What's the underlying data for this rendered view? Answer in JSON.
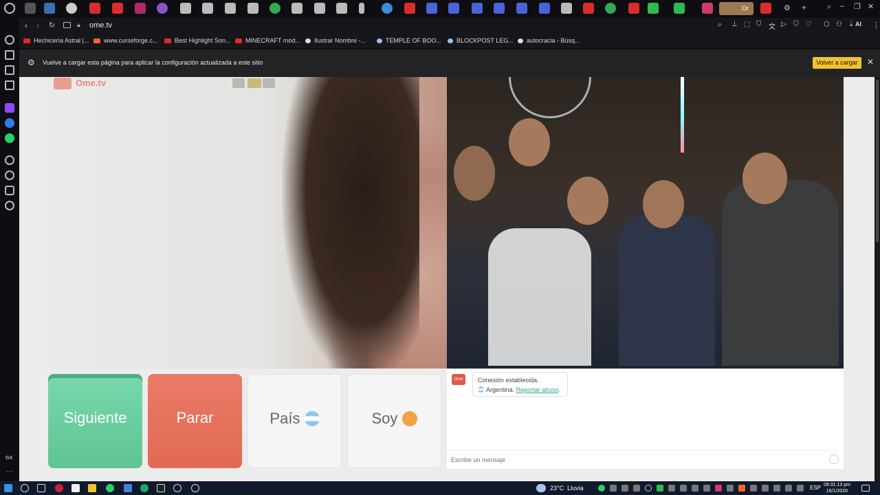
{
  "browser": {
    "url": "ome.tv",
    "bookmarks": [
      {
        "label": "Hechicería Astral |...",
        "color": "#e02b2b"
      },
      {
        "label": "www.curseforge.c...",
        "color": "#f0642e"
      },
      {
        "label": "Best Highlight Son...",
        "color": "#e02b2b"
      },
      {
        "label": "MINECRAFT mod...",
        "color": "#e02b2b"
      },
      {
        "label": "Ilustrar Nombre -...",
        "color": "#dddddd"
      },
      {
        "label": "TEMPLE OF BOO...",
        "color": "#9fc3e8"
      },
      {
        "label": "BLOCKPOST LEG...",
        "color": "#9fc3e8"
      },
      {
        "label": "autocracia - Búsq...",
        "color": "#dddddd"
      }
    ],
    "tab_badge_label": "Or",
    "ai_label": "AI",
    "gx_label": "GX"
  },
  "notification": {
    "text": "Vuelve a cargar esta página para aplicar la configuración actualizada a este sitio",
    "button_label": "Volver a cargar",
    "close_glyph": "✕"
  },
  "ometv": {
    "watermark": "Ome.tv",
    "buttons": {
      "next": "Siguiente",
      "stop": "Parar",
      "country": "País",
      "gender": "Soy"
    },
    "chat": {
      "logo_text": "Ome TV",
      "status": "Conexión establecida.",
      "country": "Argentina.",
      "report_link": "Reportar abuso",
      "input_placeholder": "Escribe un mensaje"
    },
    "accent_next": "#66c99a",
    "accent_stop": "#e4705b"
  },
  "taskbar": {
    "weather_temp": "23°C",
    "weather_desc": "Lluvia",
    "lang": "ESP",
    "time": "09:31:13 pm",
    "date": "16/1/2026"
  }
}
